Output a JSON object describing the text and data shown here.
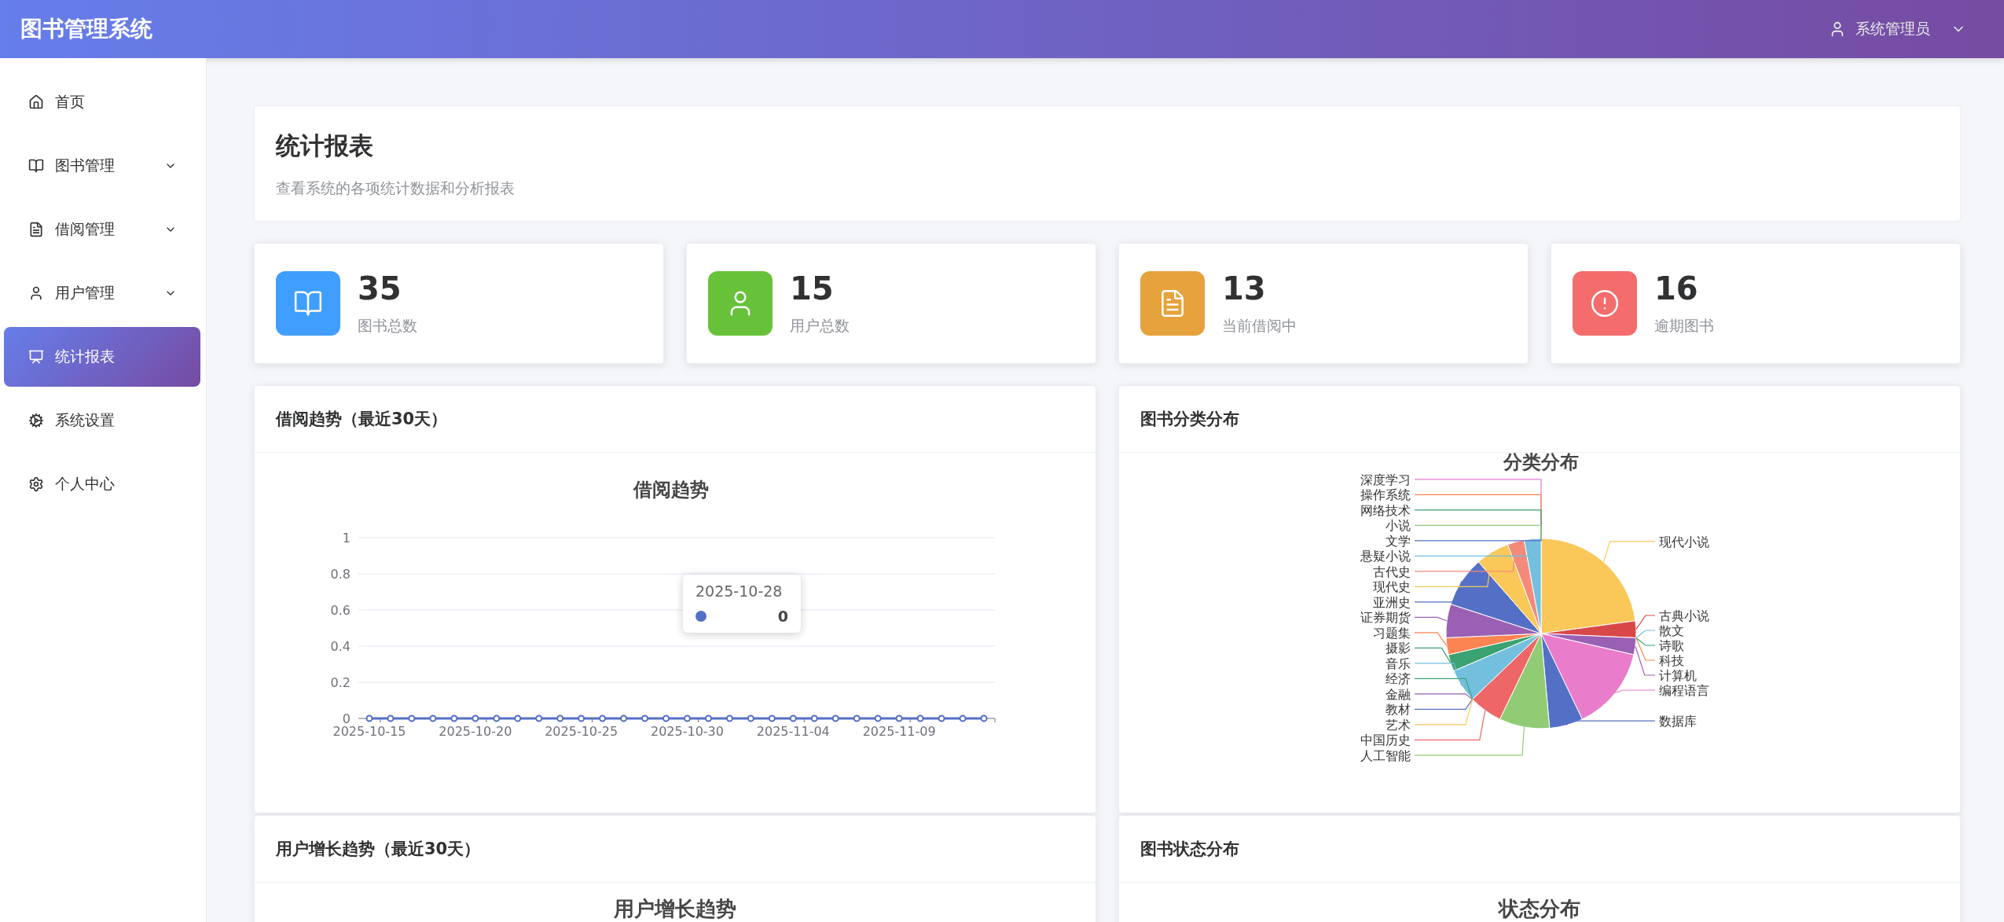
{
  "app": {
    "title": "图书管理系统",
    "user": "系统管理员"
  },
  "sidebar": {
    "items": [
      {
        "label": "首页",
        "expandable": false,
        "selected": false
      },
      {
        "label": "图书管理",
        "expandable": true,
        "selected": false
      },
      {
        "label": "借阅管理",
        "expandable": true,
        "selected": false
      },
      {
        "label": "用户管理",
        "expandable": true,
        "selected": false
      },
      {
        "label": "统计报表",
        "expandable": false,
        "selected": true
      },
      {
        "label": "系统设置",
        "expandable": false,
        "selected": false
      },
      {
        "label": "个人中心",
        "expandable": false,
        "selected": false
      }
    ]
  },
  "page": {
    "title": "统计报表",
    "subtitle": "查看系统的各项统计数据和分析报表"
  },
  "stats": [
    {
      "value": "35",
      "label": "图书总数",
      "color": "#409eff"
    },
    {
      "value": "15",
      "label": "用户总数",
      "color": "#67c23a"
    },
    {
      "value": "13",
      "label": "当前借阅中",
      "color": "#e6a23c"
    },
    {
      "value": "16",
      "label": "逾期图书",
      "color": "#f56c6c"
    }
  ],
  "panels": [
    {
      "title": "借阅趋势（最近30天）",
      "tooltip": {
        "label": "2025-10-28",
        "value": "0"
      },
      "chart_data": {
        "type": "line",
        "title": "借阅趋势",
        "categories": [
          "2025-10-15",
          null,
          null,
          null,
          null,
          "2025-10-20",
          null,
          null,
          null,
          null,
          "2025-10-25",
          null,
          null,
          null,
          null,
          "2025-10-30",
          null,
          null,
          null,
          null,
          "2025-11-04",
          null,
          null,
          null,
          null,
          "2025-11-09",
          null,
          null,
          null,
          null
        ],
        "series": [
          {
            "color": "#5470c6",
            "marker": "circle",
            "values": [
              0,
              0,
              0,
              0,
              0,
              0,
              0,
              0,
              0,
              0,
              0,
              0,
              0,
              0,
              0,
              0,
              0,
              0,
              0,
              0,
              0,
              0,
              0,
              0,
              0,
              0,
              0,
              0,
              0,
              0
            ]
          }
        ],
        "grid": true,
        "ylim": [
          0,
          1
        ],
        "yticks": [
          0,
          0.2,
          0.4,
          0.6,
          0.8,
          1
        ]
      }
    },
    {
      "title": "图书分类分布",
      "chart_data": {
        "type": "pie",
        "title": "分类分布",
        "categories": [
          "现代小说",
          "古典小说",
          "散文",
          "诗歌",
          "科技",
          "计算机",
          "编程语言",
          "数据库",
          "人工智能",
          "中国历史",
          "经济",
          "金融",
          "教材",
          "艺术",
          "音乐",
          "摄影",
          "习题集",
          "证券期货",
          "亚洲史",
          "现代史",
          "古代史",
          "悬疑小说",
          "深度学习",
          "操作系统",
          "网络技术",
          "小说",
          "文学"
        ],
        "values": [
          22.86,
          2.86,
          0,
          0,
          0,
          2.86,
          14.29,
          5.71,
          8.57,
          5.71,
          0,
          0,
          0,
          0,
          5.71,
          2.86,
          2.86,
          5.71,
          8.57,
          5.71,
          2.86,
          2.86,
          0,
          0,
          0,
          0,
          0
        ],
        "colors": [
          "#fac858",
          "#d94848",
          "#73c0de",
          "#3ba272",
          "#fc8452",
          "#9a60b4",
          "#ea7ccc",
          "#5470c6",
          "#91cc75",
          "#ee6666",
          "#3ba272",
          "#9a60b4",
          "#5470c6",
          "#fac858",
          "#73c0de",
          "#3ba272",
          "#fc8452",
          "#9a60b4",
          "#5470c6",
          "#fac858",
          "#f58a7a",
          "#73c0de",
          "#ea7ccc",
          "#fc8452",
          "#3ba272",
          "#91cc75",
          "#5470c6"
        ]
      }
    },
    {
      "title": "用户增长趋势（最近30天）",
      "chart_title": "用户增长趋势"
    },
    {
      "title": "图书状态分布",
      "chart_title": "状态分布"
    }
  ]
}
